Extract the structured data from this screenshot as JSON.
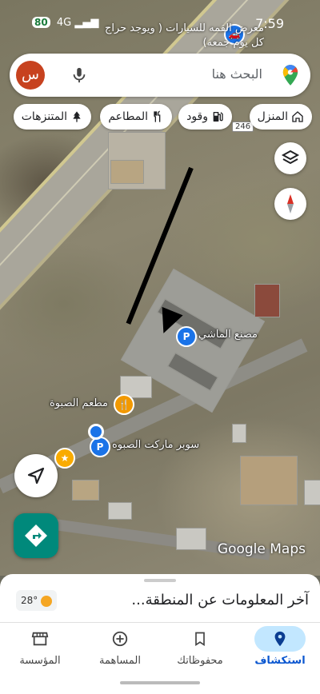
{
  "status_bar": {
    "time": "7:59",
    "network": "4G",
    "battery": "80"
  },
  "map": {
    "top_place_label": "معرض القمه للسيارات ( ويوجد حراج كل يوم جمعه)",
    "route_number": "246",
    "pois": [
      {
        "label": "مصنع الماشي",
        "pin": "P"
      },
      {
        "label": "مطعم الصبوة",
        "pin": "restaurant"
      },
      {
        "label": "سوبر ماركت الصبوه",
        "pin": "P"
      }
    ],
    "watermark": "Google Maps"
  },
  "search": {
    "avatar_letter": "س",
    "placeholder": "البحث هنا"
  },
  "chips": [
    {
      "label": "المنزل",
      "icon": "home-icon"
    },
    {
      "label": "وقود",
      "icon": "fuel-icon"
    },
    {
      "label": "المطاعم",
      "icon": "restaurant-icon"
    },
    {
      "label": "المتنزهات",
      "icon": "park-icon"
    }
  ],
  "sheet": {
    "title": "آخر المعلومات عن المنطقة...",
    "temperature": "28°"
  },
  "nav": [
    {
      "label": "استكشاف",
      "icon": "location-pin-icon",
      "active": true
    },
    {
      "label": "محفوظاتك",
      "icon": "bookmark-icon",
      "active": false
    },
    {
      "label": "المساهمة",
      "icon": "add-circle-icon",
      "active": false
    },
    {
      "label": "المؤسسة",
      "icon": "storefront-icon",
      "active": false
    }
  ],
  "colors": {
    "accent": "#0b57d0",
    "active_tab_bg": "#c2e7ff",
    "avatar": "#c7421f",
    "directions_fab": "#00897b"
  }
}
